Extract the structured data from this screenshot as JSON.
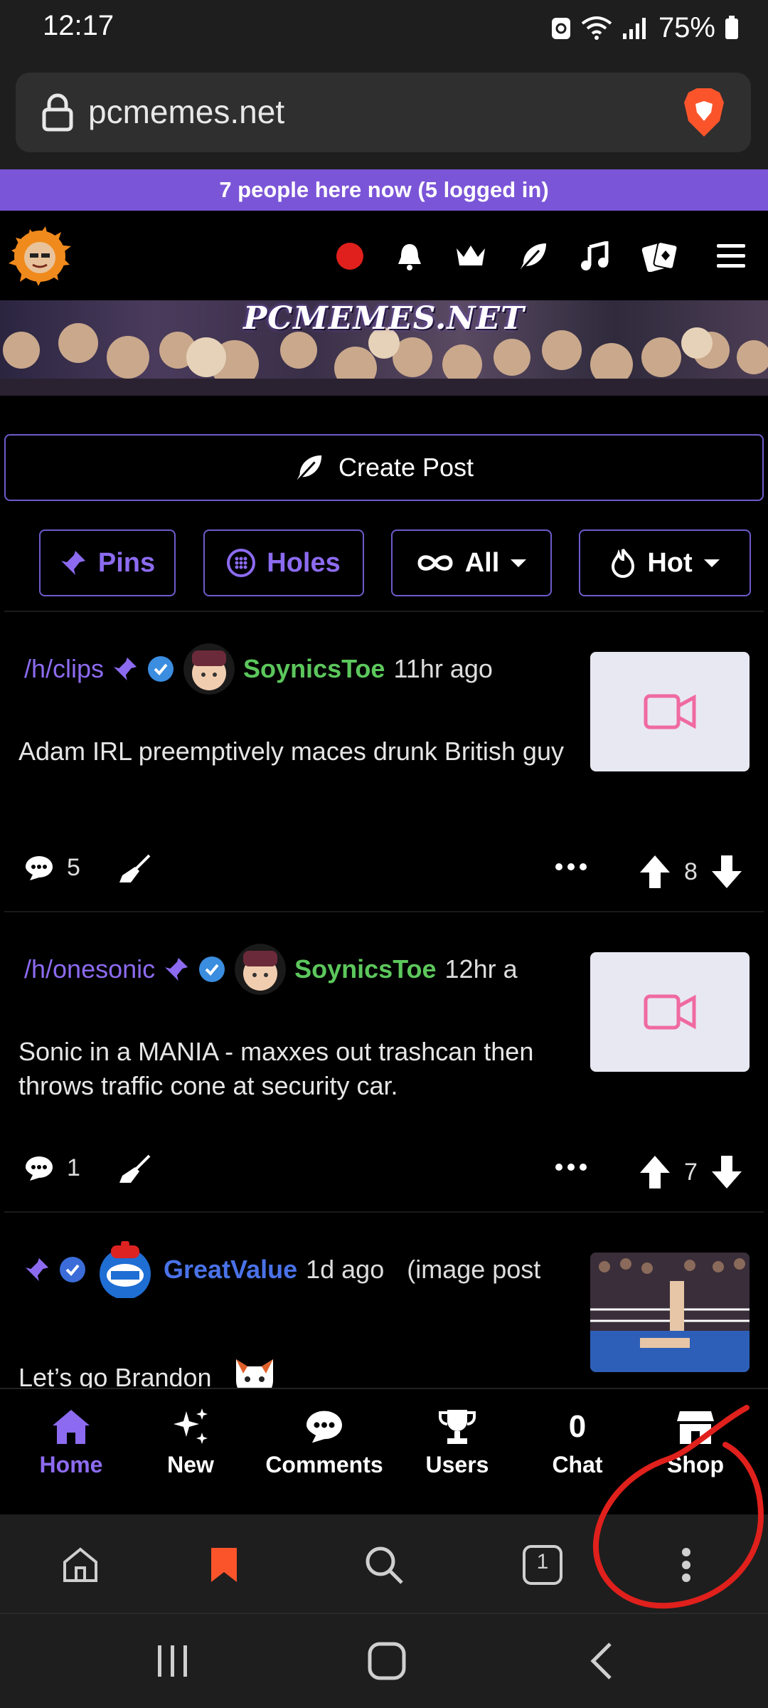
{
  "status_bar": {
    "time": "12:17",
    "battery": "75%"
  },
  "browser": {
    "url": "pcmemes.net"
  },
  "presence_banner": "7 people here now (5 logged in)",
  "banner_title": "PCMEMES.NET",
  "create_post_label": "Create Post",
  "filters": [
    {
      "label": "Pins"
    },
    {
      "label": "Holes"
    },
    {
      "label": "All"
    },
    {
      "label": "Hot"
    }
  ],
  "posts": [
    {
      "hole": "/h/clips",
      "username": "SoynicsToe",
      "age": "11hr ago",
      "title": "Adam IRL preemptively maces drunk British guy",
      "comments": "5",
      "score": "8"
    },
    {
      "hole": "/h/onesonic",
      "username": "SoynicsToe",
      "age": "12hr a",
      "title": "Sonic in a MANIA - maxxes out trashcan then throws traffic cone at security car.",
      "comments": "1",
      "score": "7"
    },
    {
      "hole": "",
      "username": "GreatValue",
      "age": "1d ago",
      "post_type": "(image post",
      "title": "Let’s go Brandon"
    }
  ],
  "bottom_nav": [
    {
      "label": "Home"
    },
    {
      "label": "New"
    },
    {
      "label": "Comments"
    },
    {
      "label": "Users"
    },
    {
      "label": "Chat",
      "count": "0"
    },
    {
      "label": "Shop"
    }
  ],
  "browser_toolbar": {
    "tab_count": "1"
  },
  "colors": {
    "accent": "#7b55d8",
    "username_green": "#5cc75c",
    "annotation": "#e0201c",
    "brave": "#fb542b"
  }
}
